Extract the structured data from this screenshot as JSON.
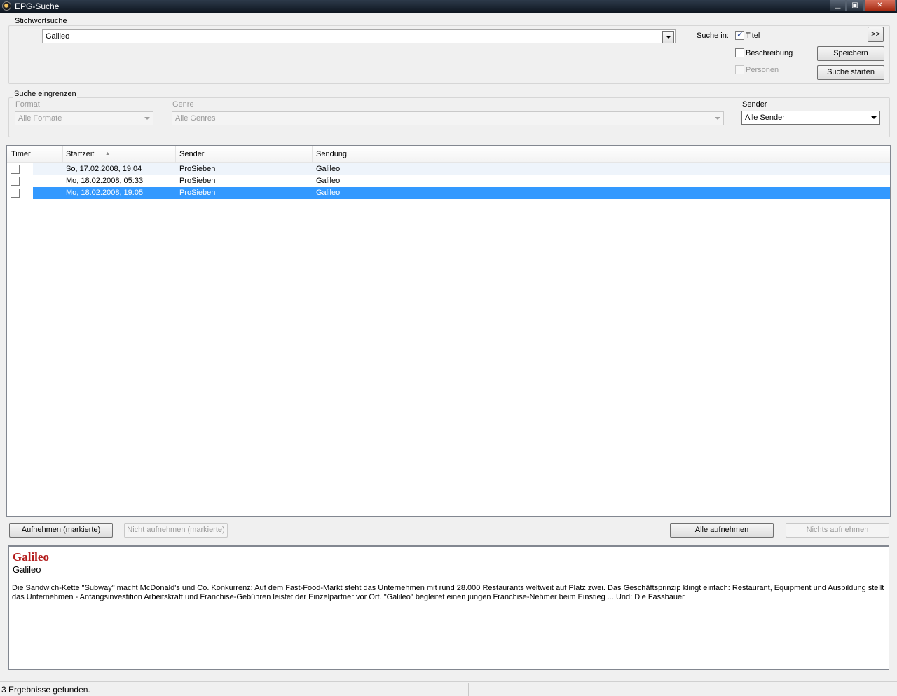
{
  "window": {
    "title": "EPG-Suche"
  },
  "keyword_search": {
    "group_label": "Stichwortsuche",
    "query": "Galileo",
    "search_in_label": "Suche in:",
    "options": [
      {
        "label": "Titel",
        "checked": true,
        "enabled": true
      },
      {
        "label": "Beschreibung",
        "checked": false,
        "enabled": true
      },
      {
        "label": "Personen",
        "checked": false,
        "enabled": false
      }
    ],
    "expand_label": ">>",
    "save_label": "Speichern",
    "start_label": "Suche starten"
  },
  "filters": {
    "group_label": "Suche eingrenzen",
    "format": {
      "label": "Format",
      "value": "Alle Formate"
    },
    "genre": {
      "label": "Genre",
      "value": "Alle Genres"
    },
    "sender": {
      "label": "Sender",
      "value": "Alle Sender"
    }
  },
  "results": {
    "columns": [
      "Timer",
      "Startzeit",
      "Sender",
      "Sendung"
    ],
    "sort_indicator": "▲",
    "rows": [
      {
        "start": "So, 17.02.2008, 19:04",
        "sender": "ProSieben",
        "show": "Galileo"
      },
      {
        "start": "Mo, 18.02.2008, 05:33",
        "sender": "ProSieben",
        "show": "Galileo"
      },
      {
        "start": "Mo, 18.02.2008, 19:05",
        "sender": "ProSieben",
        "show": "Galileo"
      }
    ]
  },
  "actions": {
    "record_marked": "Aufnehmen (markierte)",
    "not_record_marked": "Nicht aufnehmen (markierte)",
    "record_all": "Alle aufnehmen",
    "record_none": "Nichts aufnehmen"
  },
  "detail": {
    "title": "Galileo",
    "subtitle": "Galileo",
    "description": "Die Sandwich-Kette \"Subway\" macht McDonald's und Co. Konkurrenz: Auf dem Fast-Food-Markt steht das Unternehmen mit rund 28.000 Restaurants weltweit auf Platz zwei. Das Geschäftsprinzip klingt einfach: Restaurant, Equipment und Ausbildung stellt das Unternehmen - Anfangsinvestition Arbeitskraft und Franchise-Gebühren leistet der Einzelpartner vor Ort. \"Galileo\" begleitet einen jungen Franchise-Nehmer beim Einstieg ... Und: Die Fassbauer"
  },
  "status": {
    "text": "3 Ergebnisse gefunden."
  }
}
